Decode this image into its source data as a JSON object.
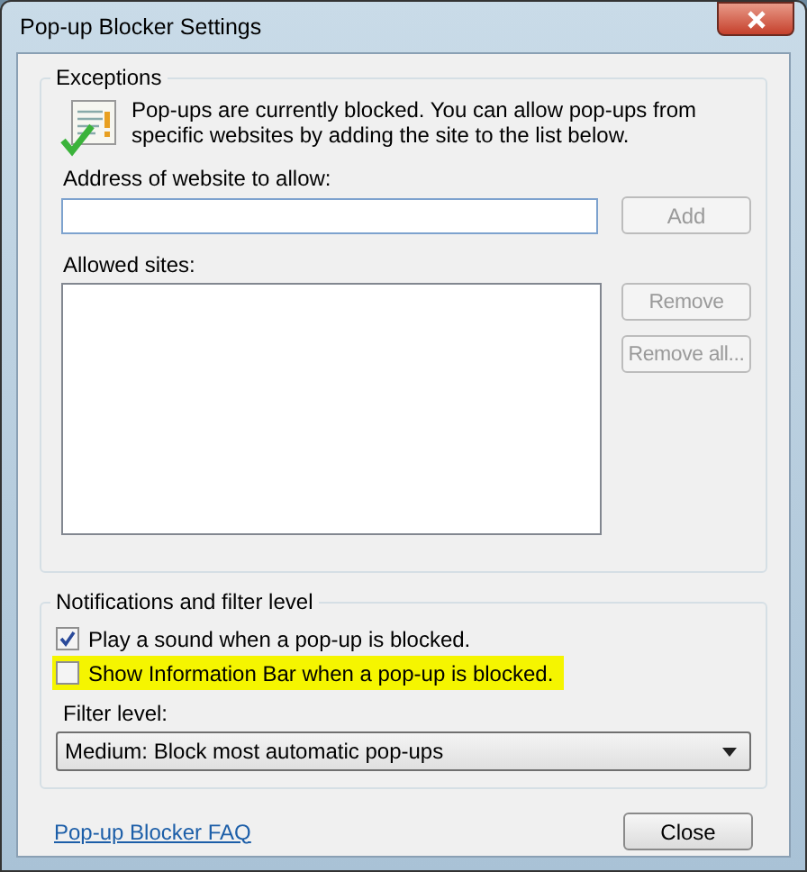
{
  "window": {
    "title": "Pop-up Blocker Settings"
  },
  "exceptions": {
    "title": "Exceptions",
    "message": "Pop-ups are currently blocked.  You can allow pop-ups from specific websites by adding the site to the list below.",
    "address_label": "Address of website to allow:",
    "add_button": {
      "label": "Add",
      "disabled": true
    },
    "allowed_label": "Allowed sites:",
    "list_buttons": [
      {
        "label": "Remove",
        "disabled": true
      },
      {
        "label": "Remove all...",
        "disabled": true
      }
    ]
  },
  "notifications": {
    "title": "Notifications and filter level",
    "options": [
      {
        "label": "Play a sound when a pop-up is blocked.",
        "checked": true,
        "highlighted": false
      },
      {
        "label": "Show Information Bar when a pop-up is blocked.",
        "checked": false,
        "highlighted": true
      }
    ],
    "filter_label": "Filter level:",
    "filter_value": "Medium: Block most automatic pop-ups"
  },
  "footer": {
    "link": "Pop-up Blocker FAQ",
    "close_button": "Close"
  }
}
